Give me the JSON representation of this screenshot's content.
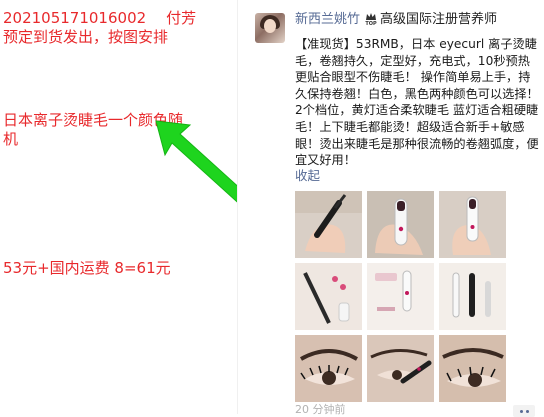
{
  "note": {
    "header_date": "202105171016002",
    "header_paid": "付芳",
    "header_line2": "预定到货发出，按图安排",
    "product_line": "日本离子烫睫毛一个颜色随机",
    "price_line": "53元+国内运费 8=61元"
  },
  "moment": {
    "author_name": "新西兰姚竹",
    "top_badge_label": "TOP",
    "author_title": "高级国际注册营养师",
    "post_text": "【准现货】53RMB，日本 eyecurl 离子烫睫毛，卷翘持久，定型好，充电式，10秒预热更贴合眼型不伤睫毛！ 操作简单易上手，持久保持卷翘！白色，黑色两种颜色可以选择！2个档位，黄灯适合柔软睫毛 蓝灯适合粗硬睫毛！上下睫毛都能烫！超级适合新手+敏感眼！烫出来睫毛是那种很流畅的卷翘弧度，便宜又好用！",
    "collapse_label": "收起",
    "time_label": "20 分钟前",
    "photos": [
      {
        "name": "photo-1",
        "icon": "hand-holding-curler"
      },
      {
        "name": "photo-2",
        "icon": "hand-holding-curler"
      },
      {
        "name": "photo-3",
        "icon": "hand-holding-curler"
      },
      {
        "name": "photo-4",
        "icon": "curler-on-lashes"
      },
      {
        "name": "photo-5",
        "icon": "curler-product"
      },
      {
        "name": "photo-6",
        "icon": "curler-product"
      },
      {
        "name": "photo-7",
        "icon": "eye-closeup"
      },
      {
        "name": "photo-8",
        "icon": "curler-use"
      },
      {
        "name": "photo-9",
        "icon": "eye-closeup"
      }
    ]
  },
  "colors": {
    "note_red": "#e8292c",
    "arrow_green": "#1ed41e",
    "wechat_link": "#576b95"
  }
}
